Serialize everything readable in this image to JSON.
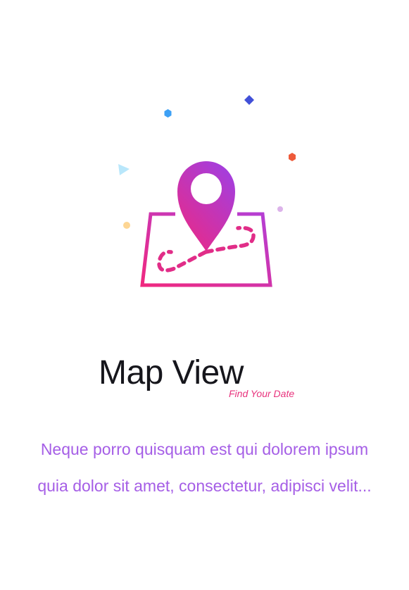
{
  "onboarding": {
    "title": "Map View",
    "tagline": "Find Your Date",
    "description": "Neque porro quisquam est qui dolorem ipsum quia dolor sit amet, consectetur, adipisci velit...",
    "illustration_icon": "map-pin-route-icon"
  },
  "colors": {
    "gradient_start": "#f0287f",
    "gradient_end": "#b33fd6",
    "title_text": "#16161c",
    "tagline_text": "#e8337d",
    "description_text": "#a55ee6",
    "confetti_blue_hex": "#3da0f5",
    "confetti_indigo_diamond": "#4150d8",
    "confetti_red_hex": "#ee5a3a",
    "confetti_cyan_triangle": "#b9e7fb",
    "confetti_yellow_dot": "#fdd694",
    "confetti_lilac_dot": "#dcb3ea"
  }
}
